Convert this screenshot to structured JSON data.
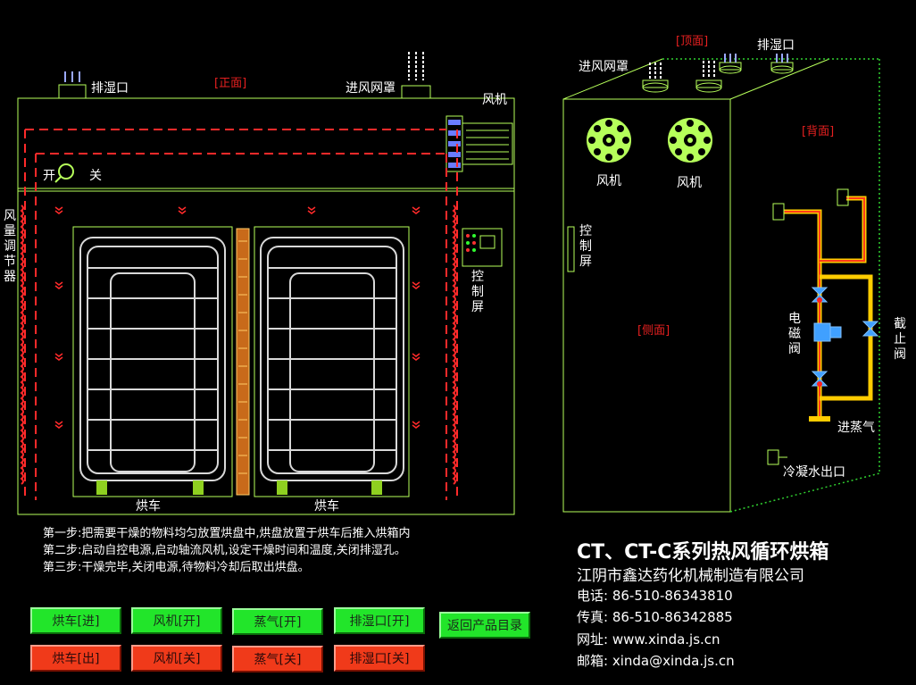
{
  "front": {
    "view_label": "[正面]",
    "exhaust_label": "排湿口",
    "intake_label": "进风网罩",
    "fan_label": "风机",
    "on_label": "开",
    "off_label": "关",
    "damper_label": "风量调节器",
    "control_label": "控制屏",
    "cart_label_left": "烘车",
    "cart_label_right": "烘车"
  },
  "side": {
    "top_label": "[顶面]",
    "back_label": "[背面]",
    "side_label": "[侧面]",
    "intake_label": "进风网罩",
    "exhaust_label": "排湿口",
    "fan1_label": "风机",
    "fan2_label": "风机",
    "control_label": "控制屏",
    "solenoid_label": "电磁阀",
    "stop_valve_label": "截止阀",
    "steam_in_label": "进蒸气",
    "condensate_label": "冷凝水出口"
  },
  "steps": [
    "第一步:把需要干燥的物料均匀放置烘盘中,烘盘放置于烘车后推入烘箱内",
    "第二步:启动自控电源,启动轴流风机,设定干燥时间和温度,关闭排湿孔。",
    "第三步:干燥完毕,关闭电源,待物料冷却后取出烘盘。"
  ],
  "buttons": {
    "cart_in": "烘车[进]",
    "fan_on": "风机[开]",
    "steam_on": "蒸气[开]",
    "exhaust_on": "排湿口[开]",
    "cart_out": "烘车[出]",
    "fan_off": "风机[关]",
    "steam_off": "蒸气[关]",
    "exhaust_off": "排湿口[关]",
    "back": "返回产品目录"
  },
  "company": {
    "product": "CT、CT-C系列热风循环烘箱",
    "name": "江阴市鑫达药化机械制造有限公司",
    "tel": "电话:  86-510-86343810",
    "fax": "传真:  86-510-86342885",
    "web": "网址: www.xinda.js.cn",
    "email": "邮箱: xinda@xinda.js.cn"
  },
  "colors": {
    "outline": "#b6ff5a",
    "airflow": "#ff2a2a",
    "green_button": "#22e52a",
    "red_button": "#f03a1a"
  }
}
